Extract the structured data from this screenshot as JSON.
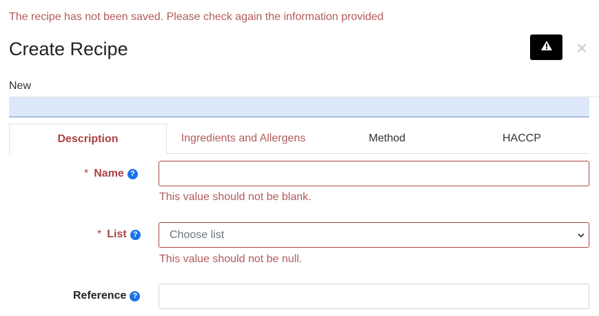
{
  "alert": {
    "message": "The recipe has not been saved. Please check again the information provided"
  },
  "modal": {
    "title": "Create Recipe",
    "status": "New",
    "warning_icon": "warning-triangle-icon",
    "close_glyph": "×"
  },
  "tabs": [
    {
      "label": "Description",
      "state": "active"
    },
    {
      "label": "Ingredients and Allergens",
      "state": "error"
    },
    {
      "label": "Method",
      "state": "normal"
    },
    {
      "label": "HACCP",
      "state": "normal"
    }
  ],
  "form": {
    "required_mark": "*",
    "help_glyph": "?",
    "name": {
      "label": "Name",
      "value": "",
      "error": "This value should not be blank."
    },
    "list": {
      "label": "List",
      "placeholder": "Choose list",
      "error": "This value should not be null."
    },
    "reference": {
      "label": "Reference",
      "value": ""
    }
  },
  "colors": {
    "error": "#a94442",
    "accent": "#1a73e8",
    "strip": "#dde9fb"
  }
}
